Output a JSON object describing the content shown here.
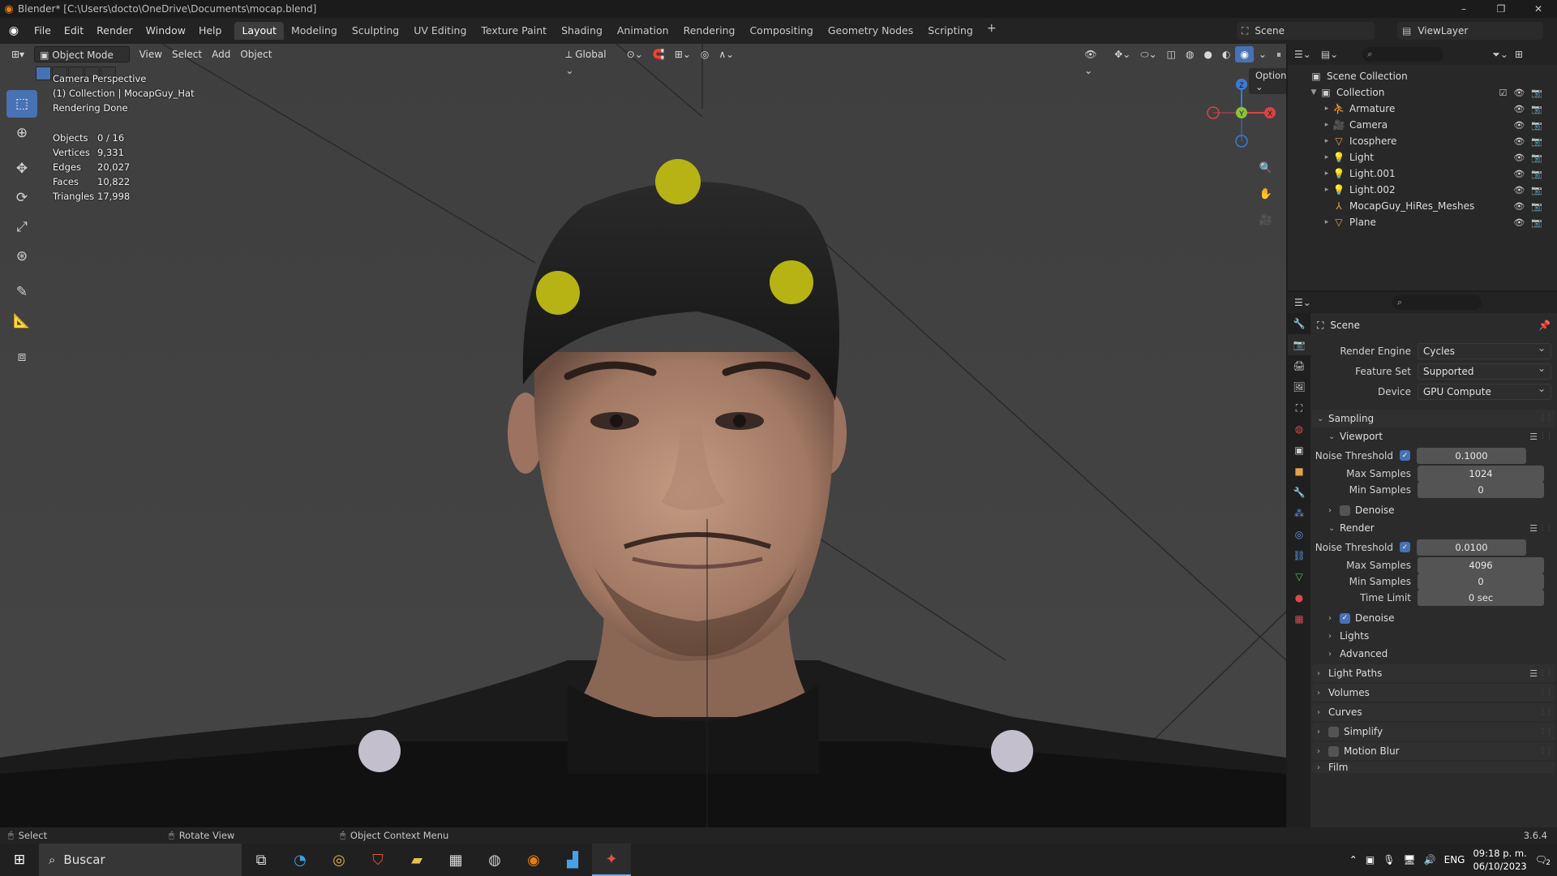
{
  "window": {
    "title": "Blender* [C:\\Users\\docto\\OneDrive\\Documents\\mocap.blend]",
    "controls": [
      "–",
      "❐",
      "✕"
    ]
  },
  "menu": [
    "File",
    "Edit",
    "Render",
    "Window",
    "Help"
  ],
  "workspaces": [
    "Layout",
    "Modeling",
    "Sculpting",
    "UV Editing",
    "Texture Paint",
    "Shading",
    "Animation",
    "Rendering",
    "Compositing",
    "Geometry Nodes",
    "Scripting"
  ],
  "active_workspace": "Layout",
  "scene_name": "Scene",
  "view_layer_name": "ViewLayer",
  "viewport_header": {
    "mode": "Object Mode",
    "menus": [
      "View",
      "Select",
      "Add",
      "Object"
    ],
    "transform_orientation": "Global",
    "options_label": "Options"
  },
  "viewport_overlay": {
    "line1": "Camera Perspective",
    "line2": "(1) Collection | MocapGuy_Hat",
    "line3": "Rendering Done"
  },
  "stats": [
    {
      "label": "Objects",
      "value": "0 / 16"
    },
    {
      "label": "Vertices",
      "value": "9,331"
    },
    {
      "label": "Edges",
      "value": "20,027"
    },
    {
      "label": "Faces",
      "value": "10,822"
    },
    {
      "label": "Triangles",
      "value": "17,998"
    }
  ],
  "gizmo": {
    "z": "Z",
    "y": "Y",
    "x": "X"
  },
  "outliner": {
    "root": "Scene Collection",
    "collection": "Collection",
    "items": [
      {
        "name": "Armature",
        "icon": "armature-icon",
        "glyph": "⛹",
        "color": "#e8a048"
      },
      {
        "name": "Camera",
        "icon": "camera-icon",
        "glyph": "🎥",
        "color": "#e8a048"
      },
      {
        "name": "Icosphere",
        "icon": "mesh-icon",
        "glyph": "▽",
        "color": "#e8a048"
      },
      {
        "name": "Light",
        "icon": "light-icon",
        "glyph": "💡",
        "color": "#e8a048"
      },
      {
        "name": "Light.001",
        "icon": "light-icon",
        "glyph": "💡",
        "color": "#e8a048"
      },
      {
        "name": "Light.002",
        "icon": "light-icon",
        "glyph": "💡",
        "color": "#e8a048"
      },
      {
        "name": "MocapGuy_HiRes_Meshes",
        "icon": "empty-icon",
        "glyph": "⅄",
        "color": "#e8a048"
      },
      {
        "name": "Plane",
        "icon": "mesh-icon",
        "glyph": "▽",
        "color": "#e8a048"
      }
    ]
  },
  "properties": {
    "context_title": "Scene",
    "render_engine_label": "Render Engine",
    "render_engine": "Cycles",
    "feature_set_label": "Feature Set",
    "feature_set": "Supported",
    "device_label": "Device",
    "device": "GPU Compute",
    "sampling": "Sampling",
    "viewport": "Viewport",
    "vp_noise_label": "Noise Threshold",
    "vp_noise": "0.1000",
    "vp_max_label": "Max Samples",
    "vp_max": "1024",
    "vp_min_label": "Min Samples",
    "vp_min": "0",
    "denoise": "Denoise",
    "render": "Render",
    "r_noise_label": "Noise Threshold",
    "r_noise": "0.0100",
    "r_max_label": "Max Samples",
    "r_max": "4096",
    "r_min_label": "Min Samples",
    "r_min": "0",
    "r_time_label": "Time Limit",
    "r_time": "0 sec",
    "r_denoise": "Denoise",
    "lights": "Lights",
    "advanced": "Advanced",
    "light_paths": "Light Paths",
    "volumes": "Volumes",
    "curves": "Curves",
    "simplify": "Simplify",
    "motion_blur": "Motion Blur",
    "film": "Film"
  },
  "statusbar": {
    "select": "Select",
    "rotate": "Rotate View",
    "context_menu": "Object Context Menu",
    "version": "3.6.4"
  },
  "taskbar": {
    "search": "Buscar",
    "lang": "ENG",
    "time": "09:18 p. m.",
    "date": "06/10/2023",
    "notifications": "2"
  },
  "colors": {
    "accent_blue": "#4772b3",
    "blender_orange": "#e87d0d",
    "viewport_bg": "#404040"
  }
}
